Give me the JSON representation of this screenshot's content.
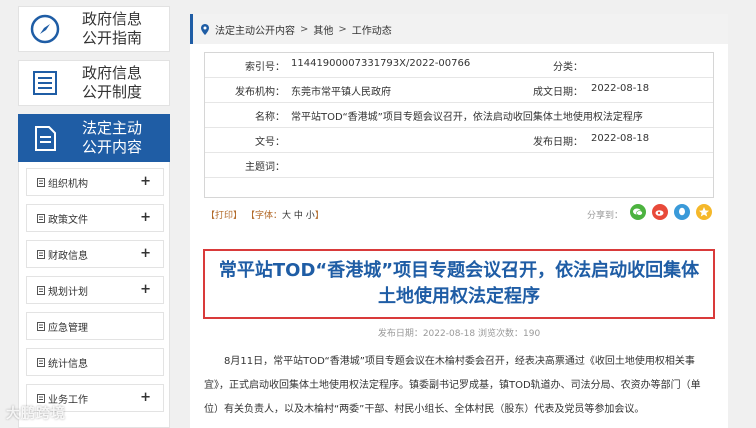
{
  "sidebar": {
    "blocks": [
      {
        "label": "政府信息公开指南"
      },
      {
        "label": "政府信息公开制度"
      },
      {
        "label": "法定主动公开内容"
      }
    ],
    "items": [
      {
        "label": "组织机构"
      },
      {
        "label": "政策文件"
      },
      {
        "label": "财政信息"
      },
      {
        "label": "规划计划"
      },
      {
        "label": "应急管理"
      },
      {
        "label": "统计信息"
      },
      {
        "label": "业务工作"
      }
    ],
    "plus": "+"
  },
  "breadcrumb": {
    "items": [
      "法定主动公开内容",
      "其他",
      "工作动态"
    ],
    "sep": ">"
  },
  "meta": {
    "index_label": "索引号：",
    "index_value": "11441900007331793X/2022-00766",
    "category_label": "分类：",
    "category_value": "",
    "publisher_label": "发布机构：",
    "publisher_value": "东莞市常平镇人民政府",
    "created_label": "成文日期：",
    "created_value": "2022-08-18",
    "name_label": "名称：",
    "name_value": "常平站TOD“香港城”项目专题会议召开，依法启动收回集体土地使用权法定程序",
    "docno_label": "文号：",
    "docno_value": "",
    "pubdate_label": "发布日期：",
    "pubdate_value": "2022-08-18",
    "keywords_label": "主题词：",
    "keywords_value": ""
  },
  "tools": {
    "print": "【打印】",
    "font_prefix": "【字体：",
    "font_large": "大",
    "font_medium": "中",
    "font_small": "小",
    "font_suffix": "】",
    "share_label": "分享到："
  },
  "share_icons": [
    "wechat-icon",
    "weibo-icon",
    "qq-icon",
    "qzone-icon"
  ],
  "article": {
    "title": "常平站TOD“香港城”项目专题会议召开，依法启动收回集体土地使用权法定程序",
    "pubinfo": "发布日期：2022-08-18  浏览次数：190",
    "paragraph": "8月11日，常平站TOD“香港城”项目专题会议在木棆村委会召开，经表决高票通过《收回土地使用权相关事宜》，正式启动收回集体土地使用权法定程序。镇委副书记罗成基，镇TOD轨道办、司法分局、农资办等部门（单位）有关负责人，以及木棆村“两委”干部、村民小组长、全体村民（股东）代表及党员等参加会议。"
  },
  "watermark": "大鹏跨境",
  "colors": {
    "accent": "#1f5da5",
    "title_border": "#d93a3a",
    "tools_text": "#b26a2a"
  }
}
